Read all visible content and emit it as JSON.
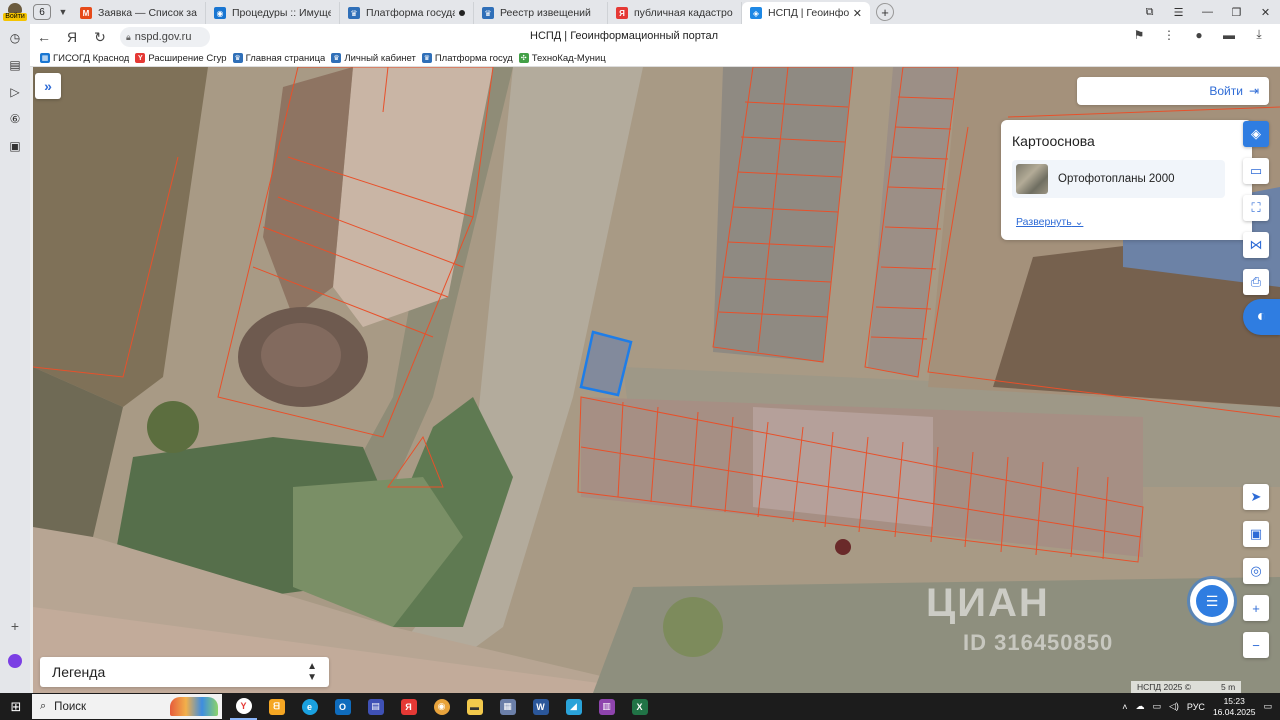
{
  "browser": {
    "profile_label": "Войти",
    "tab_count": "6",
    "tabs": [
      {
        "title": "Заявка — Список заявок",
        "fav_color": "#e64a19",
        "fav": "M"
      },
      {
        "title": "Процедуры :: Имуществе",
        "fav_color": "#1976d2",
        "fav": "◉"
      },
      {
        "title": "Платформа государств",
        "fav_color": "#2f6fb8",
        "fav": "♛"
      },
      {
        "title": "Реестр извещений",
        "fav_color": "#2f6fb8",
        "fav": "♛"
      },
      {
        "title": "публичная кадастровая к",
        "fav_color": "#e53935",
        "fav": "Я"
      },
      {
        "title": "НСПД | Геоинформаци",
        "fav_color": "#1e88e5",
        "fav": "◈"
      }
    ],
    "url": "nspd.gov.ru",
    "page_title": "НСПД | Геоинформационный портал",
    "bookmarks": [
      {
        "label": "ГИСОГД Краснод",
        "color": "#1976d2",
        "icon": "▦"
      },
      {
        "label": "Расширение Сгур",
        "color": "#e53935",
        "icon": "Y"
      },
      {
        "label": "Главная страница",
        "color": "#2f6fb8",
        "icon": "♛"
      },
      {
        "label": "Личный кабинет",
        "color": "#2f6fb8",
        "icon": "♛"
      },
      {
        "label": "Платформа госуд",
        "color": "#2f6fb8",
        "icon": "♛"
      },
      {
        "label": "ТехноКад-Муниц",
        "color": "#43a047",
        "icon": "✣"
      }
    ]
  },
  "map": {
    "login_label": "Войти",
    "basemap": {
      "title": "Картооснова",
      "selected": "Ортофотопланы 2000",
      "expand_label": "Развернуть"
    },
    "legend_label": "Легенда",
    "copyright": "НСПД 2025 ©",
    "scale_label": "5 m",
    "watermark": "ЦИАН",
    "watermark_id": "ID 316450850",
    "colors": {
      "parcel_outline": "#e8502a",
      "selected_outline": "#1e7de8",
      "accent": "#2f7de1"
    }
  },
  "taskbar": {
    "search_placeholder": "Поиск",
    "lang": "РУС",
    "time": "15:23",
    "date": "16.04.2025"
  }
}
